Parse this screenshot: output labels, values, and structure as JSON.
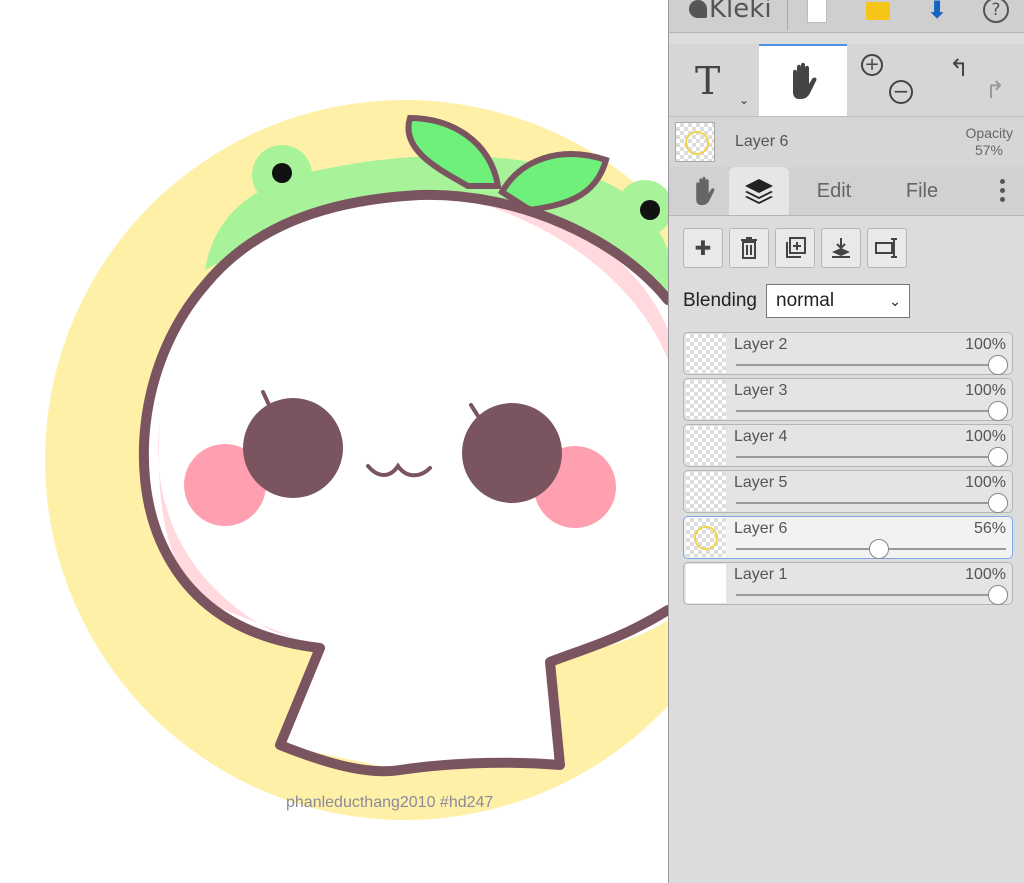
{
  "app": {
    "name": "Kleki"
  },
  "canvas": {
    "watermark": "phanleducthang2010 #hd247"
  },
  "toolbar": {
    "tools": [
      "text-tool",
      "hand-tool",
      "zoom-in",
      "zoom-out",
      "undo",
      "redo"
    ],
    "top_icons": [
      "new-page-icon",
      "open-folder-icon",
      "download-icon",
      "help-icon"
    ]
  },
  "current_layer": {
    "name": "Layer 6",
    "opacity_label": "Opacity",
    "opacity_value": "57%"
  },
  "tabs": [
    {
      "label": "",
      "icon": "hand-icon"
    },
    {
      "label": "",
      "icon": "layers-icon",
      "active": true
    },
    {
      "label": "Edit"
    },
    {
      "label": "File"
    }
  ],
  "blending": {
    "label": "Blending",
    "value": "normal"
  },
  "layers": [
    {
      "name": "Layer 2",
      "opacity": "100%",
      "level": 1.0,
      "selected": false
    },
    {
      "name": "Layer 3",
      "opacity": "100%",
      "level": 1.0,
      "selected": false
    },
    {
      "name": "Layer 4",
      "opacity": "100%",
      "level": 1.0,
      "selected": false
    },
    {
      "name": "Layer 5",
      "opacity": "100%",
      "level": 1.0,
      "selected": false
    },
    {
      "name": "Layer 6",
      "opacity": "56%",
      "level": 0.56,
      "selected": true
    },
    {
      "name": "Layer 1",
      "opacity": "100%",
      "level": 1.0,
      "selected": false
    }
  ],
  "colors": {
    "accent": "#4f8fe6",
    "panel": "#dcdcdc",
    "ring": "#f0d44a"
  }
}
